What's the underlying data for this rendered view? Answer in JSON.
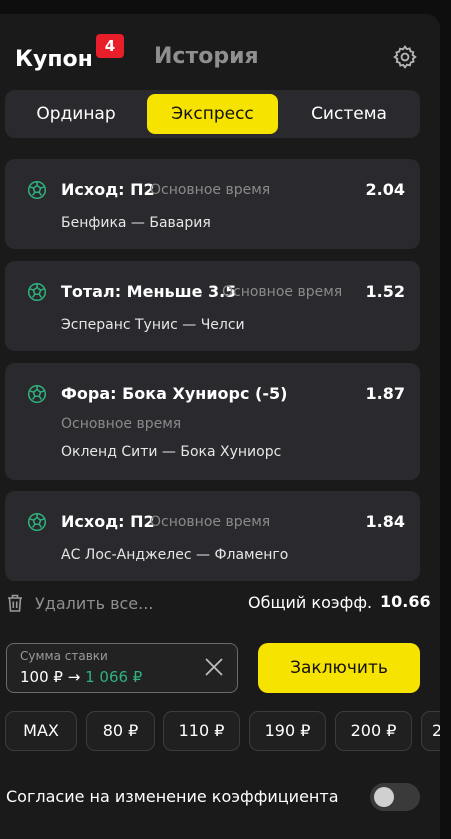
{
  "header": {
    "tab_coupon": "Купон",
    "coupon_count": "4",
    "tab_history": "История"
  },
  "bet_types": [
    {
      "label": "Ординар",
      "active": false
    },
    {
      "label": "Экспресс",
      "active": true
    },
    {
      "label": "Система",
      "active": false
    }
  ],
  "bets": [
    {
      "market": "Исход: П2",
      "period": "Основное время",
      "odds": "2.04",
      "match": "Бенфика — Бавария"
    },
    {
      "market": "Тотал: Меньше 3.5",
      "period": "Основное время",
      "odds": "1.52",
      "match": "Эсперанс Тунис — Челси"
    },
    {
      "market": "Фора: Бока Хуниорс (-5)",
      "period": "Основное время",
      "odds": "1.87",
      "match": "Окленд Сити — Бока Хуниорс"
    },
    {
      "market": "Исход: П2",
      "period": "Основное время",
      "odds": "1.84",
      "match": "АС Лос-Анджелес — Фламенго"
    }
  ],
  "footer": {
    "delete_all": "Удалить все...",
    "total_odds_label": "Общий коэфф.",
    "total_odds_value": "10.66"
  },
  "stake": {
    "label": "Сумма ставки",
    "amount": "100 ₽",
    "arrow": "→",
    "potential_win": "1 066 ₽"
  },
  "place_button": "Заключить",
  "quick_amounts": [
    "MAX",
    "80 ₽",
    "110 ₽",
    "190 ₽",
    "200 ₽",
    "2"
  ],
  "consent_label": "Согласие на изменение коэффициента",
  "colors": {
    "accent": "#f7e300",
    "badge": "#e81e2b",
    "win": "#2fb27d",
    "icon": "#2fb27d"
  }
}
